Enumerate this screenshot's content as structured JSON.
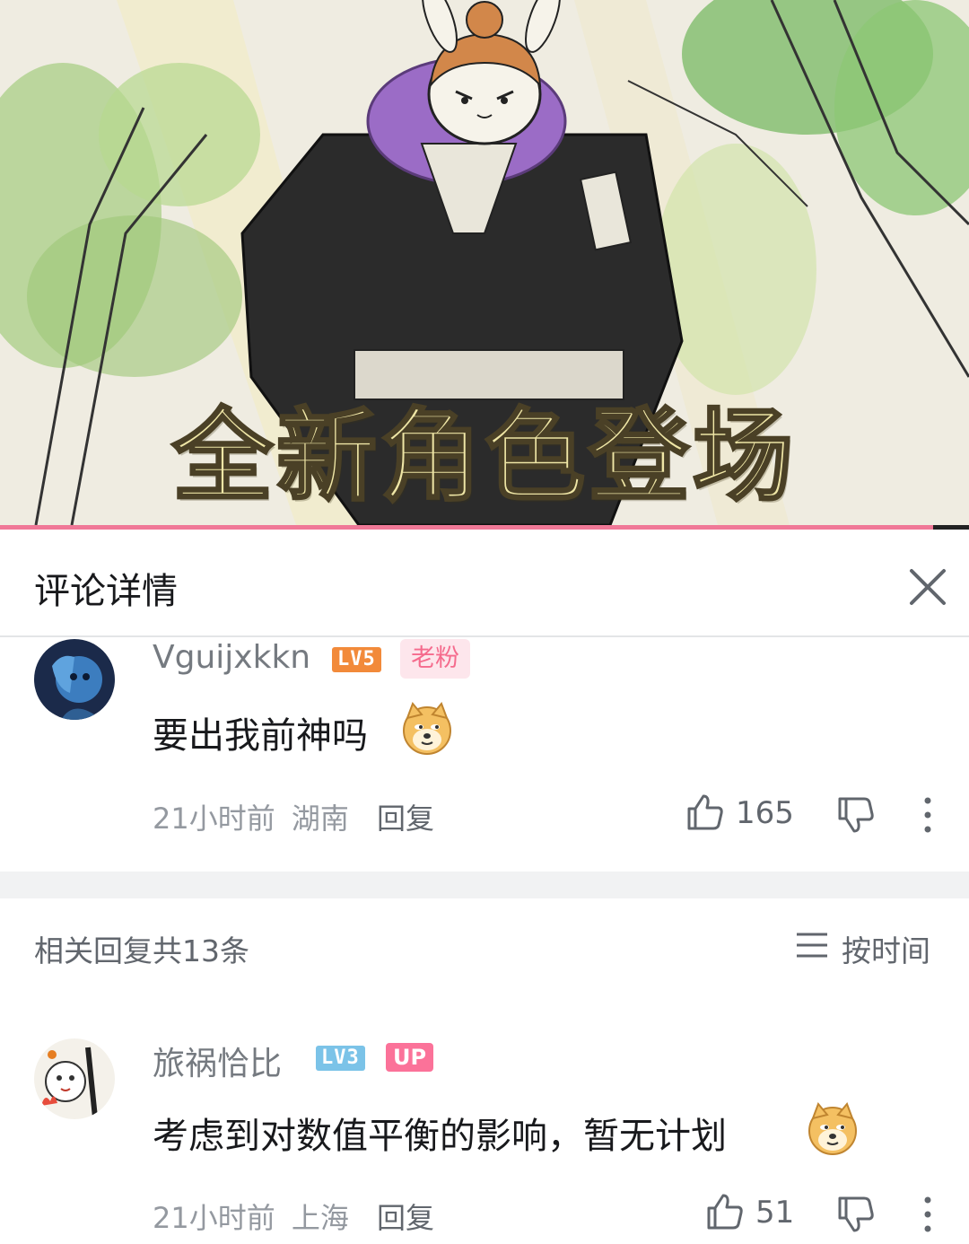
{
  "video": {
    "overlay_caption": "全新角色登场",
    "progress_fraction": 0.963
  },
  "header": {
    "title": "评论详情"
  },
  "main_comment": {
    "username": "Vguijxkkn",
    "level": "LV5",
    "tag": "老粉",
    "text": "要出我前神吗",
    "time": "21小时前",
    "location": "湖南",
    "reply_label": "回复",
    "likes": "165",
    "colors": {
      "level_badge": "#f28a3a",
      "tag_bg": "#fde6ec",
      "tag_text": "#f56b8d"
    }
  },
  "replies_header": {
    "count_label": "相关回复共13条",
    "sort_label": "按时间"
  },
  "reply": {
    "username": "旅祸恰比",
    "level": "LV3",
    "tag": "UP",
    "text": "考虑到对数值平衡的影响，暂无计划",
    "time": "21小时前",
    "location": "上海",
    "reply_label": "回复",
    "likes": "51",
    "colors": {
      "level_badge": "#7bc3e8",
      "tag_bg": "#fb7299",
      "tag_text": "#ffffff"
    }
  },
  "icons": [
    "close-icon",
    "thumbs-up-icon",
    "thumbs-down-icon",
    "more-vertical-icon",
    "sort-lines-icon",
    "doge-emoji-icon"
  ]
}
